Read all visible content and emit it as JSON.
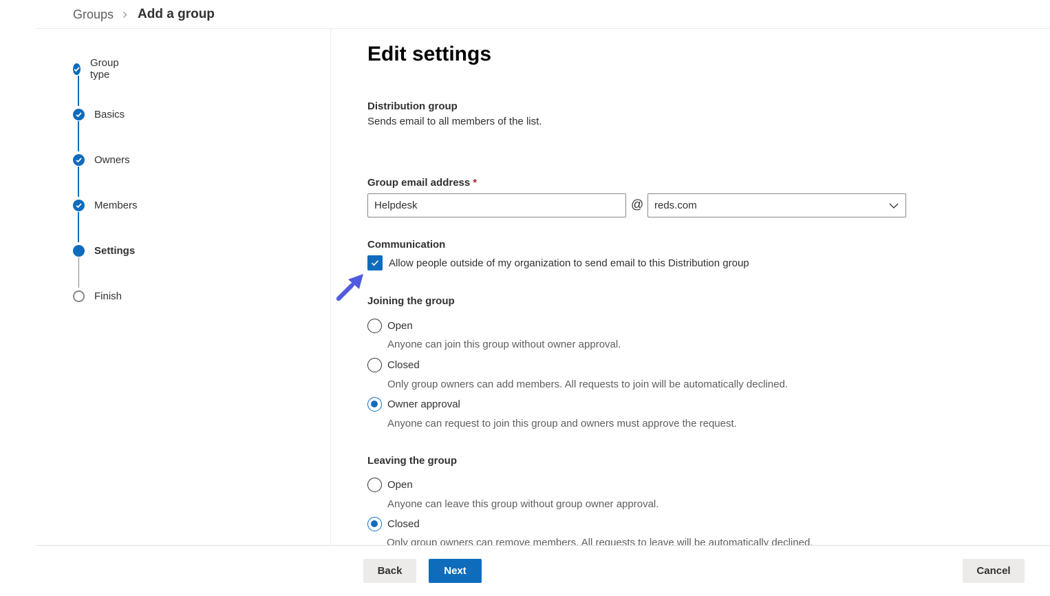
{
  "breadcrumb": {
    "root": "Groups",
    "current": "Add a group"
  },
  "stepper": {
    "steps": [
      {
        "label": "Group type",
        "state": "done"
      },
      {
        "label": "Basics",
        "state": "done"
      },
      {
        "label": "Owners",
        "state": "done"
      },
      {
        "label": "Members",
        "state": "done"
      },
      {
        "label": "Settings",
        "state": "current"
      },
      {
        "label": "Finish",
        "state": "pending"
      }
    ]
  },
  "main": {
    "title": "Edit settings",
    "group_type": {
      "name": "Distribution group",
      "description": "Sends email to all members of the list."
    },
    "email": {
      "label": "Group email address",
      "required_mark": "*",
      "value": "Helpdesk",
      "at": "@",
      "domain": "reds.com"
    },
    "communication": {
      "heading": "Communication",
      "checkbox_label": "Allow people outside of my organization to send email to this Distribution group",
      "checked": true
    },
    "joining": {
      "heading": "Joining the group",
      "options": [
        {
          "label": "Open",
          "description": "Anyone can join this group without owner approval.",
          "selected": false
        },
        {
          "label": "Closed",
          "description": "Only group owners can add members. All requests to join will be automatically declined.",
          "selected": false
        },
        {
          "label": "Owner approval",
          "description": "Anyone can request to join this group and owners must approve the request.",
          "selected": true
        }
      ]
    },
    "leaving": {
      "heading": "Leaving the group",
      "options": [
        {
          "label": "Open",
          "description": "Anyone can leave this group without group owner approval.",
          "selected": false
        },
        {
          "label": "Closed",
          "description": "Only group owners can remove members. All requests to leave will be automatically declined.",
          "selected": true
        }
      ]
    }
  },
  "footer": {
    "back": "Back",
    "next": "Next",
    "cancel": "Cancel"
  },
  "colors": {
    "accent": "#0f6cbd",
    "arrow": "#4f5bdc",
    "divider": "#edebe9"
  }
}
